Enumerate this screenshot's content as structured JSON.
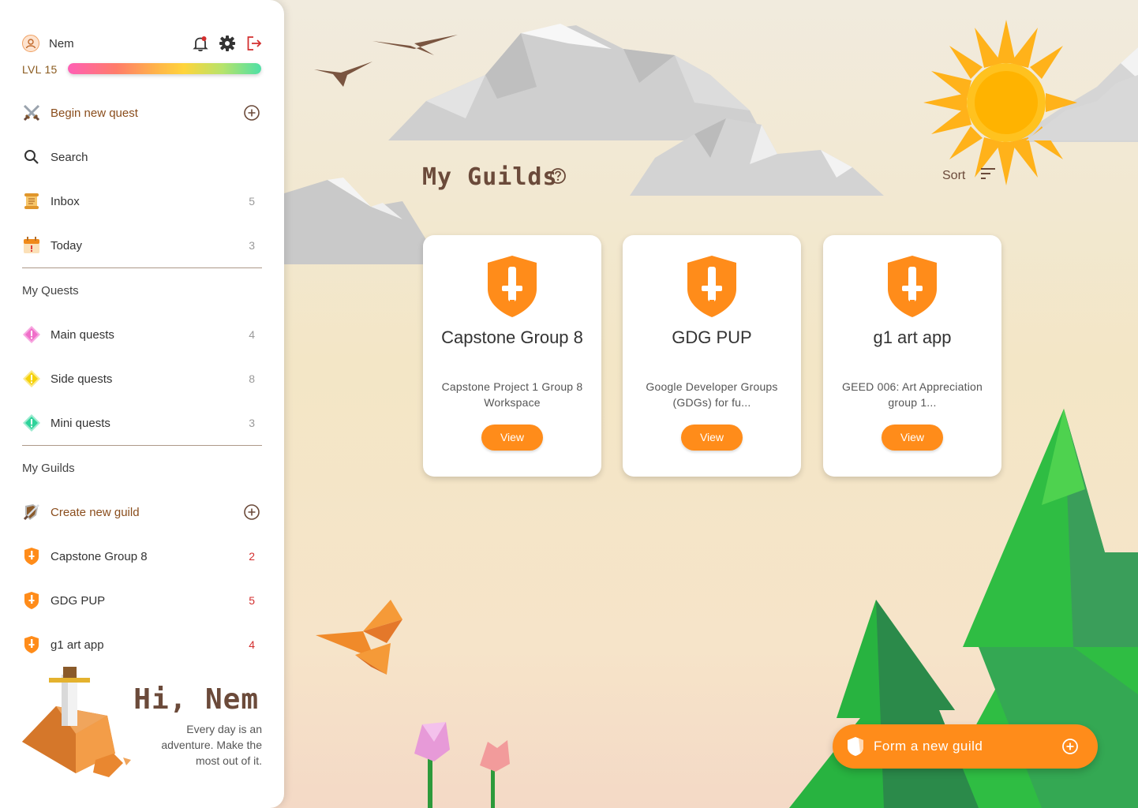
{
  "profile": {
    "name": "Nem",
    "level_label": "LVL 15",
    "xp_fraction": 1.0
  },
  "sidebar": {
    "begin_quest": "Begin new quest",
    "search": "Search",
    "inbox": {
      "label": "Inbox",
      "count": "5"
    },
    "today": {
      "label": "Today",
      "count": "3"
    },
    "my_quests_heading": "My Quests",
    "quests": [
      {
        "label": "Main quests",
        "count": "4",
        "color": "#f06fc9"
      },
      {
        "label": "Side quests",
        "count": "8",
        "color": "#f5d20a"
      },
      {
        "label": "Mini quests",
        "count": "3",
        "color": "#2ed39a"
      }
    ],
    "my_guilds_heading": "My Guilds",
    "create_guild": "Create new guild",
    "guilds": [
      {
        "label": "Capstone Group 8",
        "count": "2"
      },
      {
        "label": "GDG PUP",
        "count": "5"
      },
      {
        "label": "g1 art app",
        "count": "4"
      }
    ],
    "greeting_title": "Hi, Nem",
    "greeting_text": "Every day is an adventure. Make the most out of it."
  },
  "main": {
    "title": "My Guilds",
    "sort_label": "Sort",
    "cards": [
      {
        "name": "Capstone Group 8",
        "desc": "Capstone Project 1 Group 8 Workspace",
        "button": "View"
      },
      {
        "name": "GDG PUP",
        "desc": "Google Developer Groups (GDGs) for fu...",
        "button": "View"
      },
      {
        "name": "g1 art app",
        "desc": "GEED 006: Art Appreciation group 1...",
        "button": "View"
      }
    ],
    "fab_label": "Form a new guild"
  },
  "colors": {
    "accent": "#ff8c1a",
    "brown_text": "#6b4a3a",
    "alert_red": "#d32f2f"
  }
}
